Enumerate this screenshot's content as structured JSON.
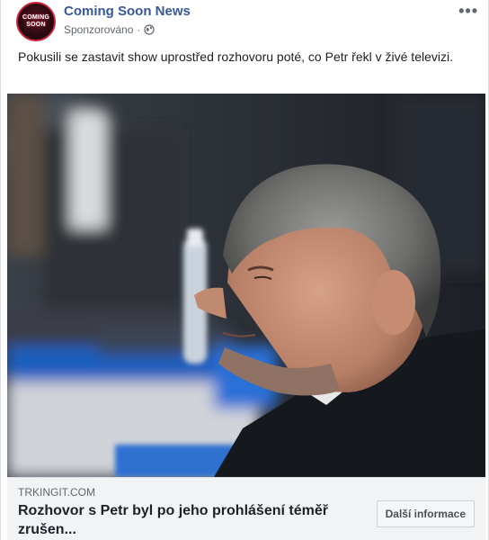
{
  "post": {
    "page_name": "Coming Soon News",
    "avatar": {
      "line1": "COMING",
      "line2": "SOON"
    },
    "sponsored_label": "Sponzorováno",
    "separator": "·",
    "more_menu": "•••",
    "icons": {
      "privacy": "globe-icon",
      "more": "more-options-icon"
    },
    "text": "Pokusili se zastavit show uprostřed rozhovoru poté, co Petr řekl v živé televizi.",
    "link": {
      "domain": "TRKINGIT.COM",
      "headline": "Rozhovor s Petr byl po jeho prohlášení téměř zrušen...",
      "cta_label": "Další informace"
    },
    "colors": {
      "page_name": "#385898",
      "link_bar": "#f2f3f5",
      "avatar_ring": "#c8233b"
    }
  }
}
